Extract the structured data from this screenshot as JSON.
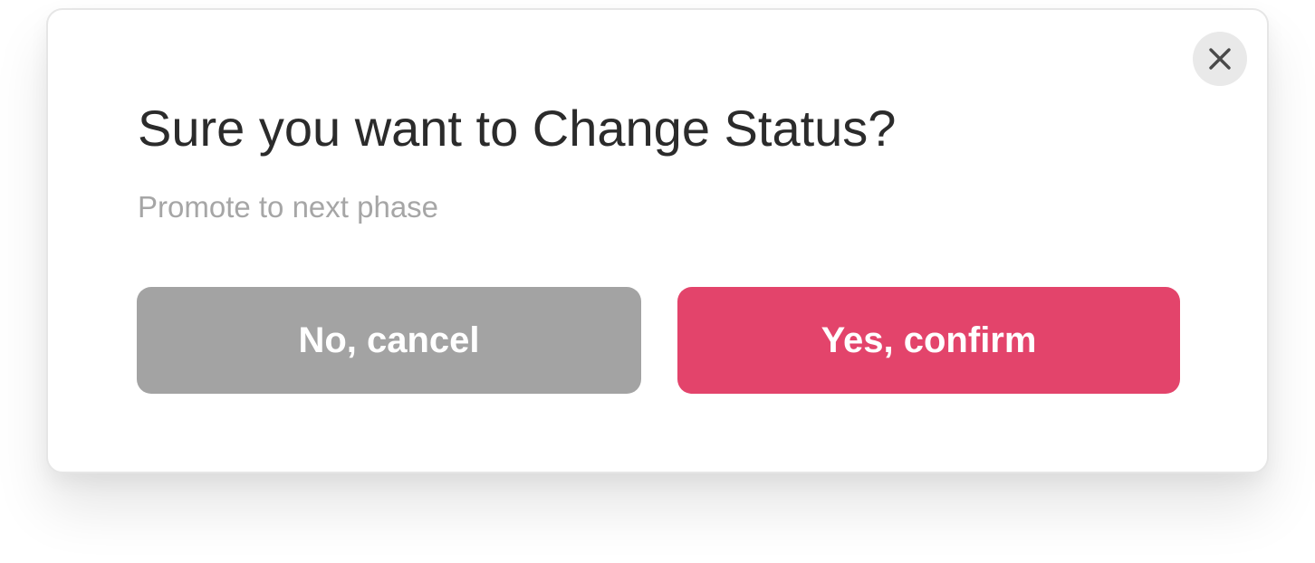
{
  "dialog": {
    "title": "Sure you want to Change Status?",
    "subtitle": "Promote to next phase",
    "cancel_label": "No, cancel",
    "confirm_label": "Yes, confirm",
    "close_icon": "close-icon"
  },
  "colors": {
    "cancel_bg": "#a3a3a3",
    "confirm_bg": "#e3446b",
    "title_text": "#2b2b2b",
    "subtitle_text": "#a6a6a6",
    "close_bg": "#e9e9e9",
    "close_glyph": "#4a4a4a"
  }
}
